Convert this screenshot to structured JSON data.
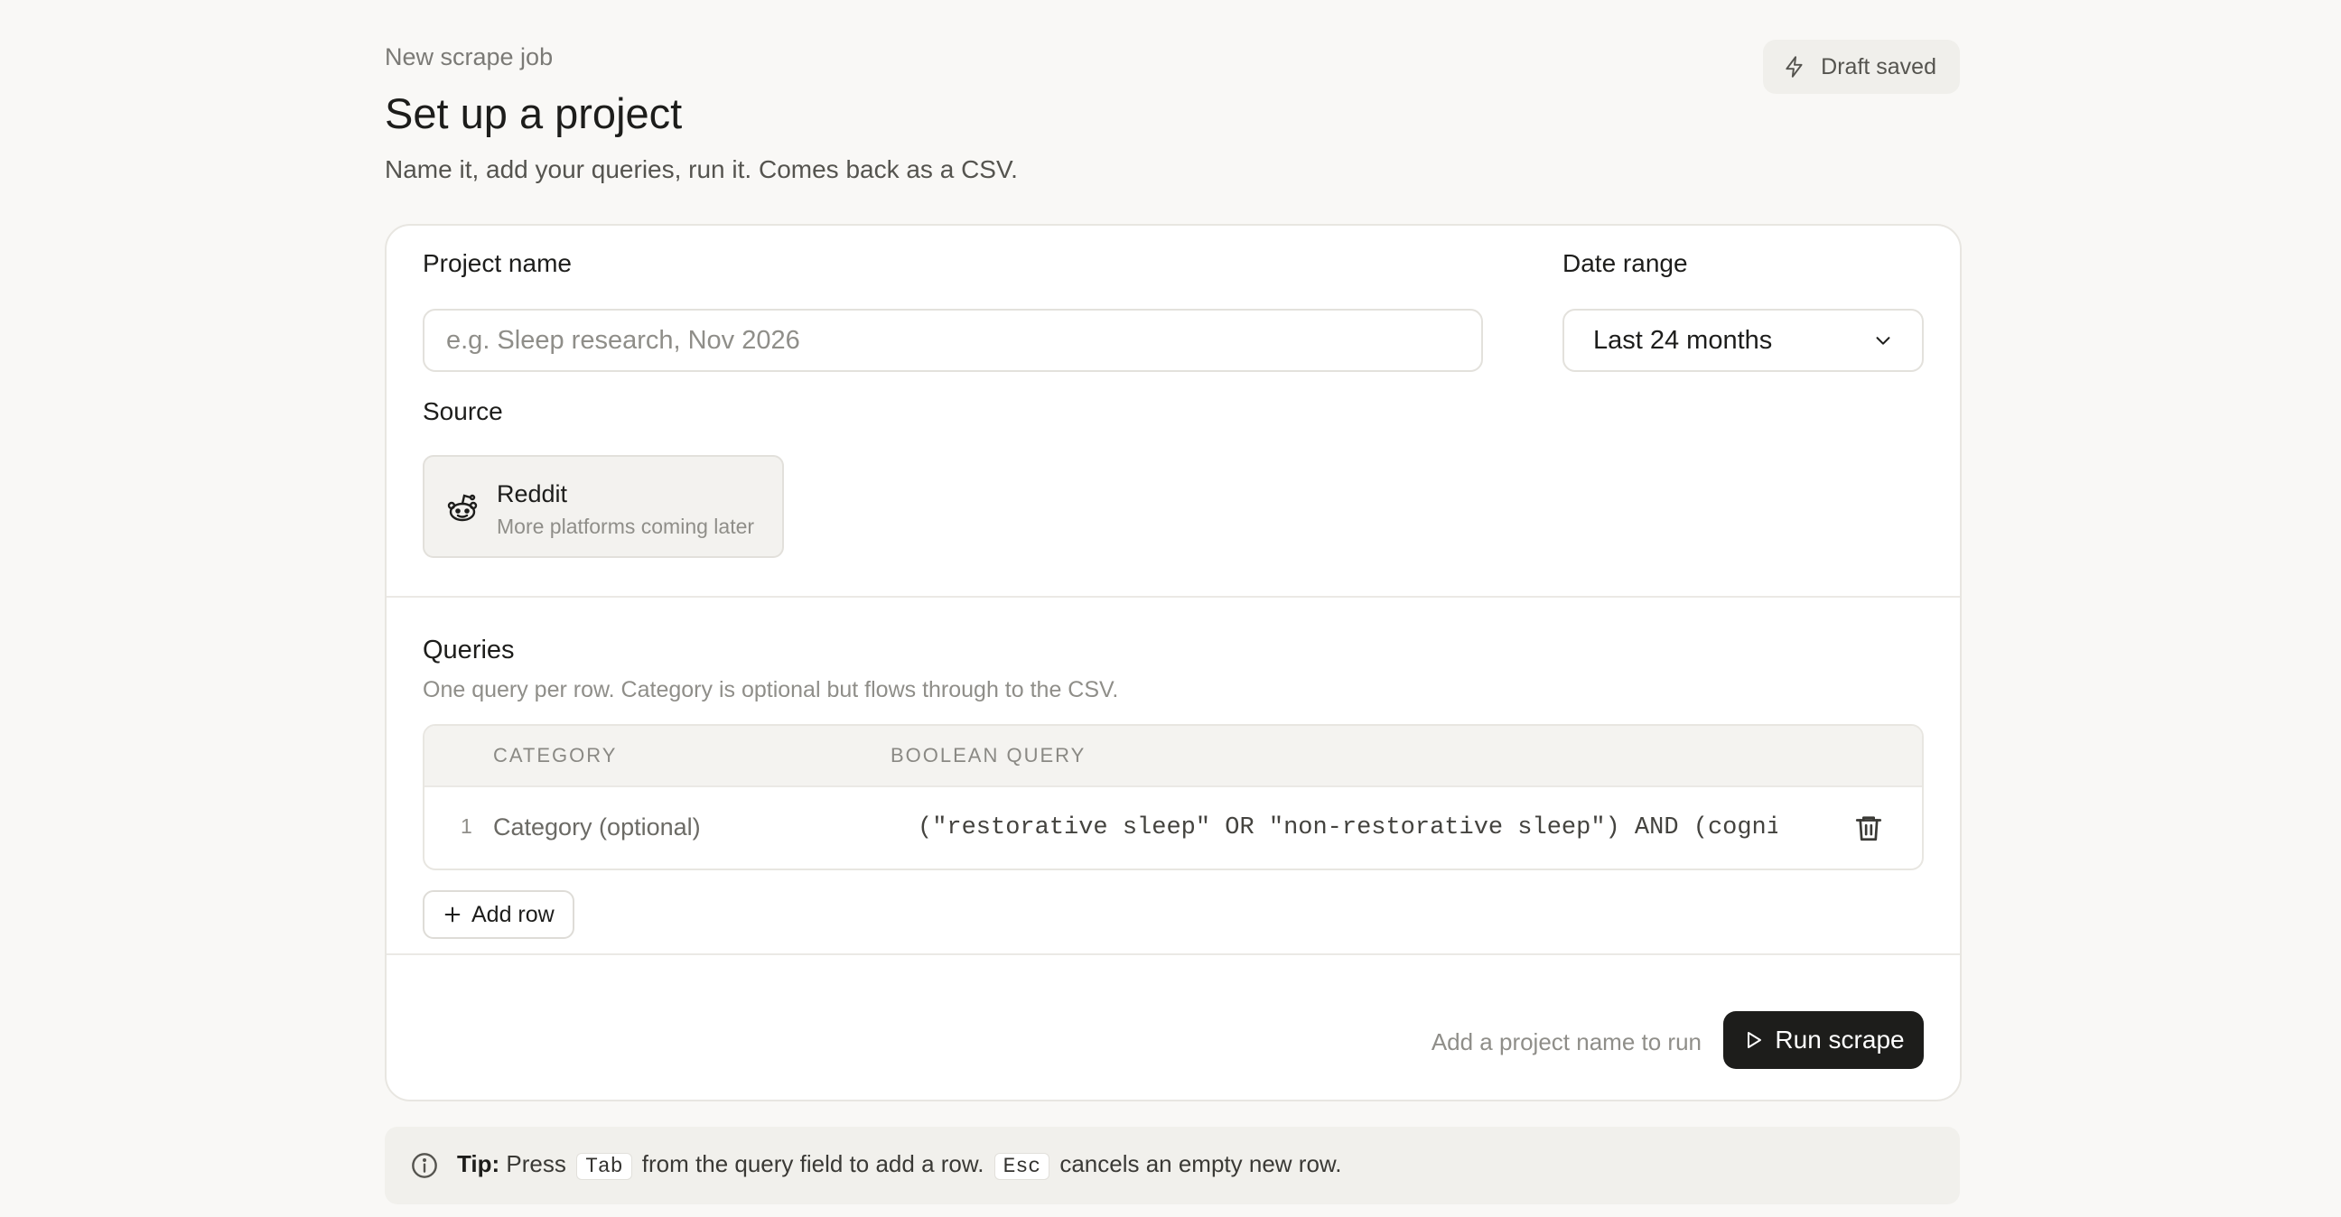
{
  "header": {
    "eyebrow": "New scrape job",
    "title": "Set up a project",
    "subtitle": "Name it, add your queries, run it. Comes back as a CSV.",
    "draft_status": "Draft saved",
    "draft_icon": "bolt-icon"
  },
  "form": {
    "project_name_label": "Project name",
    "project_name_value": "",
    "project_name_placeholder": "e.g. Sleep research, Nov 2026",
    "date_range_label": "Date range",
    "date_range_value": "Last 24 months",
    "source_label": "Source",
    "source": {
      "name": "Reddit",
      "note": "More platforms coming later",
      "icon": "reddit-icon"
    }
  },
  "queries": {
    "title": "Queries",
    "description": "One query per row. Category is optional but flows through to the CSV.",
    "columns": [
      "CATEGORY",
      "BOOLEAN QUERY"
    ],
    "rows": [
      {
        "index": "1",
        "category_value": "",
        "category_placeholder": "Category (optional)",
        "query": "(\"restorative sleep\" OR \"non-restorative sleep\") AND (cognitiv"
      }
    ],
    "add_row_label": "Add row"
  },
  "footer": {
    "hint": "Add a project name to run",
    "run_label": "Run scrape"
  },
  "tip": {
    "label": "Tip:",
    "part1": "Press",
    "key1": "Tab",
    "part2": "from the query field to add a row.",
    "key2": "Esc",
    "part3": "cancels an empty new row."
  },
  "colors": {
    "background": "#f9f8f6",
    "primary_button": "#1d1d1b",
    "muted_text": "#8f8e89"
  }
}
